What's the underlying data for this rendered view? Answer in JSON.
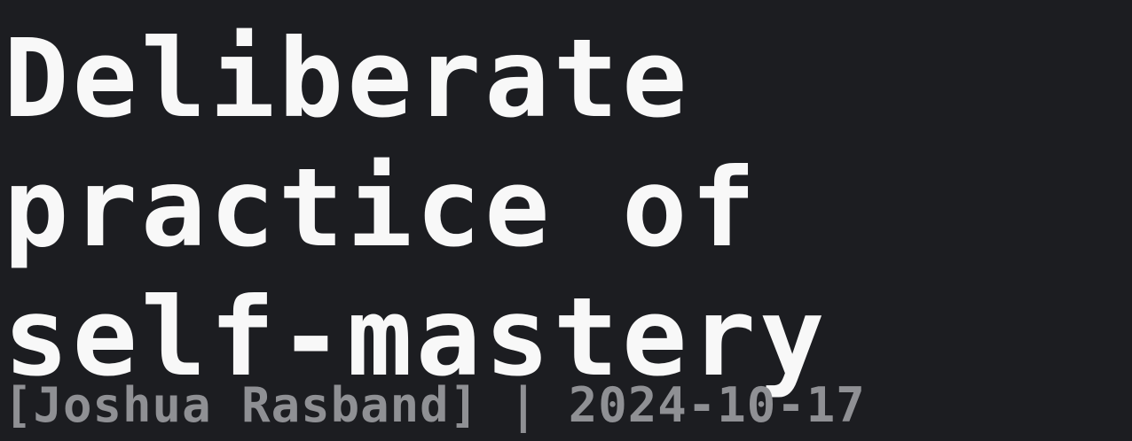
{
  "title": {
    "lines": [
      "Deliberate",
      "practice of",
      "self-mastery"
    ]
  },
  "byline": {
    "text": "[Joshua Rasband] | 2024-10-17"
  },
  "colors": {
    "background": "#1c1d21",
    "title": "#f8f8f8",
    "byline": "#8f9094"
  }
}
